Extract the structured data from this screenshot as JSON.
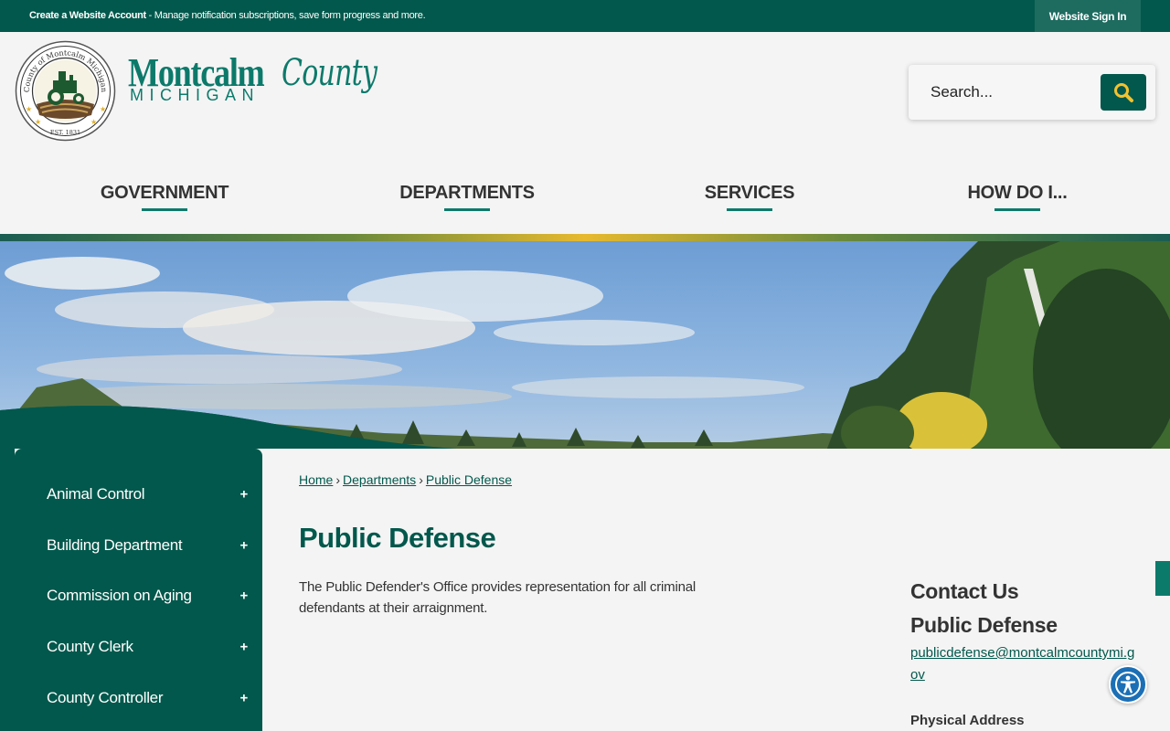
{
  "topbar": {
    "account_link": "Create a Website Account",
    "account_desc": " - Manage notification subscriptions, save form progress and more.",
    "signin": "Website Sign In"
  },
  "logo": {
    "seal_text": "County of Montcalm Michigan",
    "seal_est": "EST. 1831",
    "name_main": "Montcalm",
    "name_county": "County",
    "name_state": "MICHIGAN"
  },
  "search": {
    "placeholder": "Search..."
  },
  "nav": [
    {
      "label": "GOVERNMENT"
    },
    {
      "label": "DEPARTMENTS"
    },
    {
      "label": "SERVICES"
    },
    {
      "label": "HOW DO I..."
    }
  ],
  "sidebar": {
    "items": [
      {
        "label": "Animal Control",
        "toggle": "+"
      },
      {
        "label": "Building Department",
        "toggle": "+"
      },
      {
        "label": "Commission on Aging",
        "toggle": "+"
      },
      {
        "label": "County Clerk",
        "toggle": "+"
      },
      {
        "label": "County Controller",
        "toggle": "+"
      }
    ]
  },
  "breadcrumb": {
    "items": [
      "Home",
      "Departments",
      "Public Defense"
    ],
    "separator": "›"
  },
  "page": {
    "title": "Public Defense",
    "description": "The Public Defender's Office provides representation for all criminal defendants at their arraignment."
  },
  "contact": {
    "heading": "Contact Us",
    "name": "Public Defense",
    "email": "publicdefense@montcalmcountymi.gov",
    "address_label": "Physical Address"
  },
  "colors": {
    "primary": "#02584c",
    "accent": "#0c7a6b",
    "gold": "#e7b92f",
    "search_icon": "#f2c230",
    "accessibility": "#1b6fb5"
  },
  "icons": {
    "search": "search-icon",
    "accessibility": "accessibility-icon",
    "expand": "plus-icon"
  }
}
